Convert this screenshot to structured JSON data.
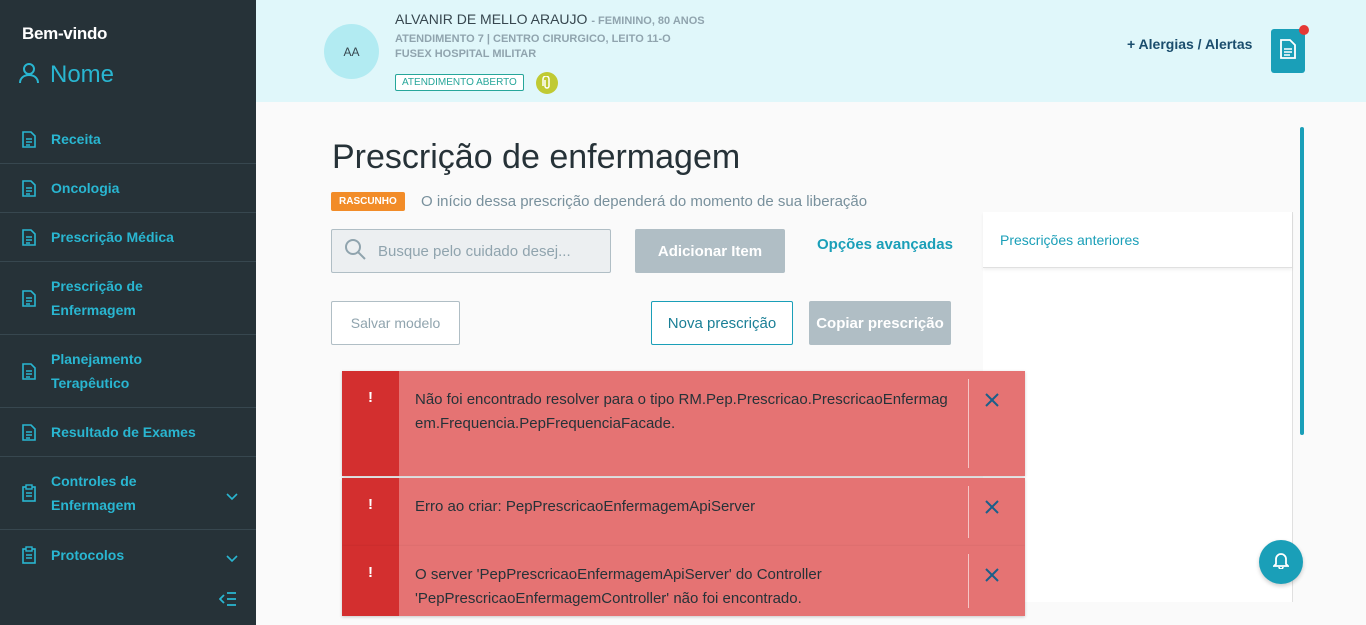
{
  "sidebar": {
    "welcome": "Bem-vindo",
    "user_name": "Nome",
    "items": [
      {
        "label": "Receita",
        "icon": "document-icon"
      },
      {
        "label": "Oncologia",
        "icon": "document-icon"
      },
      {
        "label": "Prescrição Médica",
        "icon": "document-icon"
      },
      {
        "label": "Prescrição de Enfermagem",
        "icon": "document-icon"
      },
      {
        "label": "Planejamento Terapêutico",
        "icon": "document-icon"
      },
      {
        "label": "Resultado de Exames",
        "icon": "document-icon"
      },
      {
        "label": "Controles de Enfermagem",
        "icon": "clipboard-icon"
      },
      {
        "label": "Protocolos",
        "icon": "clipboard-icon"
      }
    ]
  },
  "header": {
    "avatar_initials": "AA",
    "patient_name": "ALVANIR DE MELLO ARAUJO",
    "patient_meta": "- FEMININO, 80 ANOS",
    "attendance_line": "ATENDIMENTO 7 | CENTRO CIRURGICO, LEITO 11-O",
    "hospital": "FUSEX HOSPITAL MILITAR",
    "status": "ATENDIMENTO ABERTO",
    "allergies_link": "Alergias / Alertas"
  },
  "main": {
    "title": "Prescrição de enfermagem",
    "draft_badge": "RASCUNHO",
    "draft_note": "O início dessa prescrição dependerá do momento de sua liberação",
    "search_placeholder": "Busque pelo cuidado desej...",
    "add_item_label": "Adicionar Item",
    "advanced_options": "Opções avançadas",
    "save_model_label": "Salvar modelo",
    "new_prescription_label": "Nova prescrição",
    "copy_prescription_label": "Copiar prescrição",
    "previous_prescriptions": "Prescrições anteriores"
  },
  "toasts": [
    {
      "mark": "!",
      "message": "Não foi encontrado resolver para o tipo RM.Pep.Prescricao.PrescricaoEnfermagem.Frequencia.PepFrequenciaFacade."
    },
    {
      "mark": "!",
      "message": "Erro ao criar: PepPrescricaoEnfermagemApiServer"
    },
    {
      "mark": "!",
      "message": "O server 'PepPrescricaoEnfermagemApiServer' do Controller 'PepPrescricaoEnfermagemController' não foi encontrado."
    }
  ],
  "colors": {
    "sidebar_bg": "#263238",
    "accent": "#1a9fb8",
    "header_bg": "#e0f7fa",
    "draft": "#f28c28",
    "toast_bg": "#e57373",
    "toast_mark": "#d32f2f"
  }
}
